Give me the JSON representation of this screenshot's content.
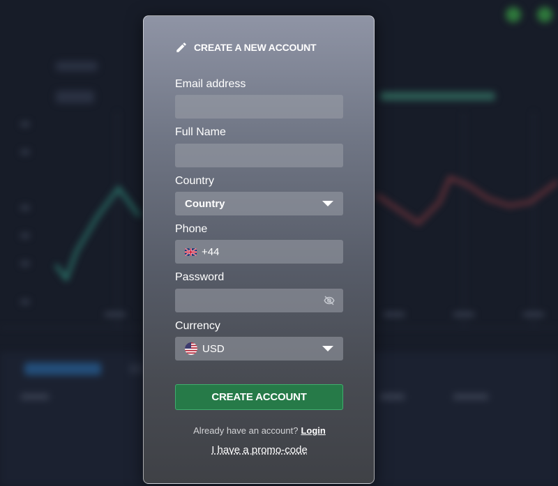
{
  "form": {
    "title": "CREATE A NEW ACCOUNT",
    "email": {
      "label": "Email address",
      "value": "",
      "placeholder": ""
    },
    "full_name": {
      "label": "Full Name",
      "value": "",
      "placeholder": ""
    },
    "country": {
      "label": "Country",
      "selected": "Country"
    },
    "phone": {
      "label": "Phone",
      "prefix": "+44",
      "flag": "uk-flag-icon"
    },
    "password": {
      "label": "Password",
      "value": "",
      "toggle_icon": "eye-off-icon"
    },
    "currency": {
      "label": "Currency",
      "selected": "USD",
      "flag": "us-flag-icon"
    },
    "submit_label": "CREATE ACCOUNT",
    "login_prompt": "Already have an account?",
    "login_link": "Login",
    "promo_link": "I have a promo-code"
  },
  "colors": {
    "submit_bg": "#267a48",
    "submit_border": "#3fae6e",
    "background": "#171c28"
  }
}
